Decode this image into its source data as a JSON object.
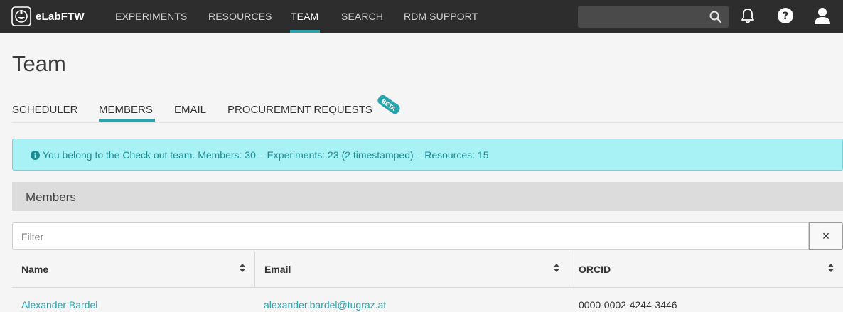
{
  "navbar": {
    "brand": "eLabFTW",
    "links": [
      "EXPERIMENTS",
      "RESOURCES",
      "TEAM",
      "SEARCH",
      "RDM SUPPORT"
    ],
    "active": "TEAM",
    "search_placeholder": "",
    "icons": [
      "search-icon",
      "bell-icon",
      "help-icon",
      "user-icon"
    ]
  },
  "page": {
    "title": "Team"
  },
  "tabs": {
    "items": [
      "SCHEDULER",
      "MEMBERS",
      "EMAIL",
      "PROCUREMENT REQUESTS"
    ],
    "active": "MEMBERS",
    "badge": "BETA"
  },
  "alert": {
    "icon": "info-icon",
    "text": "You belong to the Check out team. Members: 30 – Experiments: 23 (2 timestamped) – Resources: 15"
  },
  "members": {
    "heading": "Members",
    "filter_placeholder": "Filter",
    "clear_label": "×",
    "columns": [
      "Name",
      "Email",
      "ORCID"
    ],
    "rows": [
      {
        "name": "Alexander Bardel",
        "email": "alexander.bardel@tugraz.at",
        "orcid": "0000-0002-4244-3446"
      }
    ]
  },
  "colors": {
    "navbar": "#2d2d2d",
    "accent": "#27a4ad",
    "alert_bg": "#a8f1f4",
    "link": "#2aa3ad"
  }
}
